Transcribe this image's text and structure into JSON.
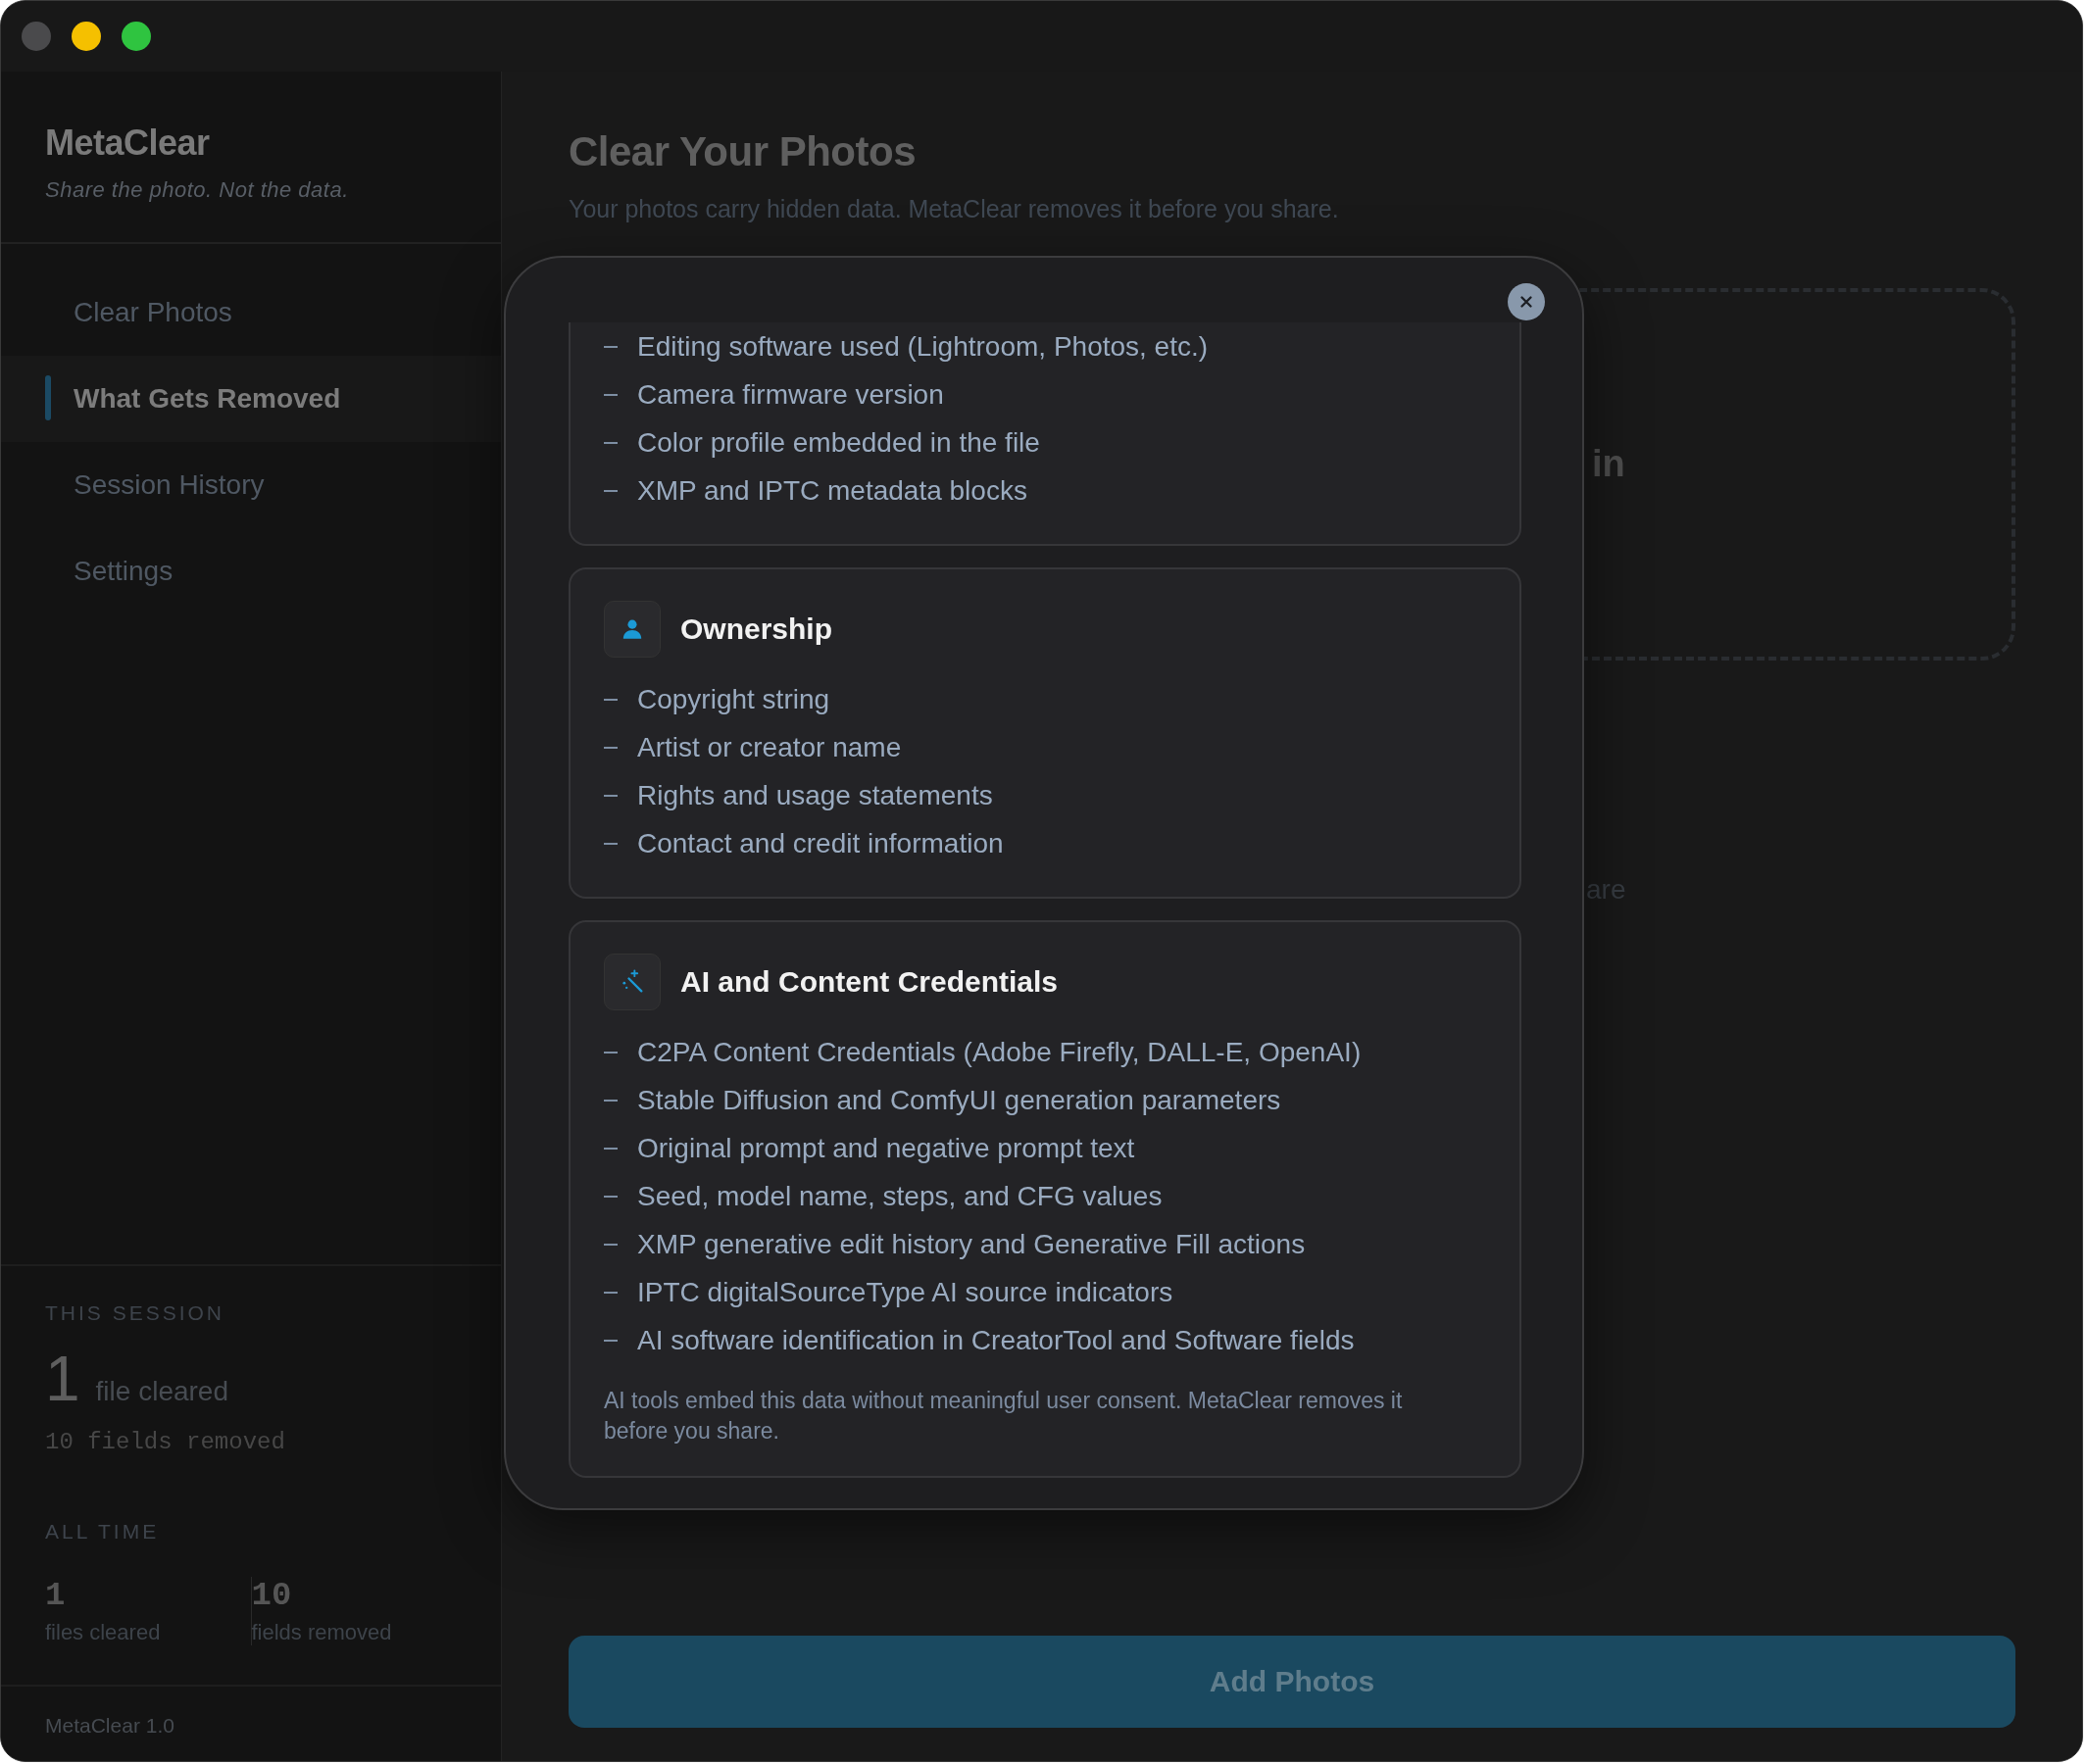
{
  "sidebar": {
    "app_name": "MetaClear",
    "tagline": "Share the photo. Not the data.",
    "nav": [
      {
        "label": "Clear Photos",
        "selected": false
      },
      {
        "label": "What Gets Removed",
        "selected": true
      },
      {
        "label": "Session History",
        "selected": false
      },
      {
        "label": "Settings",
        "selected": false
      }
    ],
    "this_session": {
      "heading": "THIS SESSION",
      "count": "1",
      "count_label": "file cleared",
      "fields": "10 fields removed"
    },
    "all_time": {
      "heading": "ALL TIME",
      "stats": [
        {
          "value": "1",
          "label": "files cleared"
        },
        {
          "value": "10",
          "label": "fields removed"
        }
      ]
    },
    "version": "MetaClear 1.0"
  },
  "main": {
    "title": "Clear Your Photos",
    "subtitle": "Your photos carry hidden data. MetaClear removes it before you share.",
    "drop_zone_fragments": [
      "in",
      "are"
    ],
    "add_button": "Add Photos"
  },
  "modal": {
    "sections": [
      {
        "items": [
          "Editing software used (Lightroom, Photos, etc.)",
          "Camera firmware version",
          "Color profile embedded in the file",
          "XMP and IPTC metadata blocks"
        ]
      },
      {
        "kind": "person",
        "title": "Ownership",
        "items": [
          "Copyright string",
          "Artist or creator name",
          "Rights and usage statements",
          "Contact and credit information"
        ]
      },
      {
        "kind": "wand",
        "title": "AI and Content Credentials",
        "items": [
          "C2PA Content Credentials (Adobe Firefly, DALL-E, OpenAI)",
          "Stable Diffusion and ComfyUI generation parameters",
          "Original prompt and negative prompt text",
          "Seed, model name, steps, and CFG values",
          "XMP generative edit history and Generative Fill actions",
          "IPTC digitalSourceType AI source indicators",
          "AI software identification in CreatorTool and Software fields"
        ],
        "note": "AI tools embed this data without meaningful user consent. MetaClear removes it before you share."
      }
    ]
  }
}
